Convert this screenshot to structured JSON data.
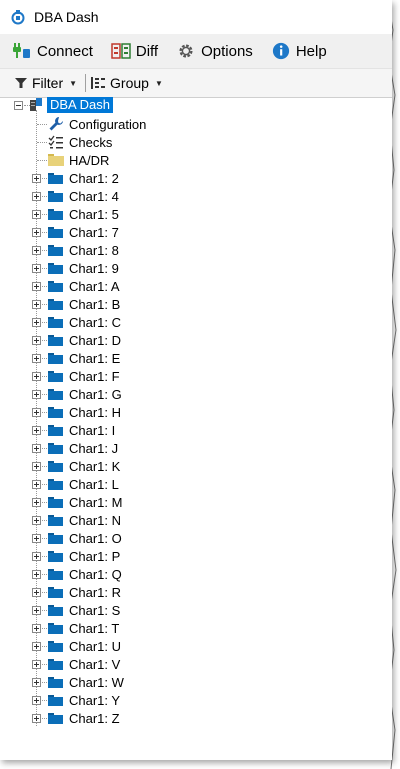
{
  "window": {
    "title": "DBA Dash"
  },
  "menu": {
    "connect": "Connect",
    "diff": "Diff",
    "options": "Options",
    "help": "Help"
  },
  "toolbar": {
    "filter": "Filter",
    "group": "Group"
  },
  "tree": {
    "root": "DBA Dash",
    "fixed_items": [
      {
        "label": "Configuration",
        "icon": "wrench-icon"
      },
      {
        "label": "Checks",
        "icon": "checklist-icon"
      },
      {
        "label": "HA/DR",
        "icon": "folder-icon"
      }
    ],
    "groups": [
      "Char1: 2",
      "Char1: 4",
      "Char1: 5",
      "Char1: 7",
      "Char1: 8",
      "Char1: 9",
      "Char1: A",
      "Char1: B",
      "Char1: C",
      "Char1: D",
      "Char1: E",
      "Char1: F",
      "Char1: G",
      "Char1: H",
      "Char1: I",
      "Char1: J",
      "Char1: K",
      "Char1: L",
      "Char1: M",
      "Char1: N",
      "Char1: O",
      "Char1: P",
      "Char1: Q",
      "Char1: R",
      "Char1: S",
      "Char1: T",
      "Char1: U",
      "Char1: V",
      "Char1: W",
      "Char1: Y",
      "Char1: Z"
    ]
  },
  "colors": {
    "selection": "#0078d7",
    "folder_group": "#0b6eb8",
    "folder_hadr": "#e8d27a"
  }
}
